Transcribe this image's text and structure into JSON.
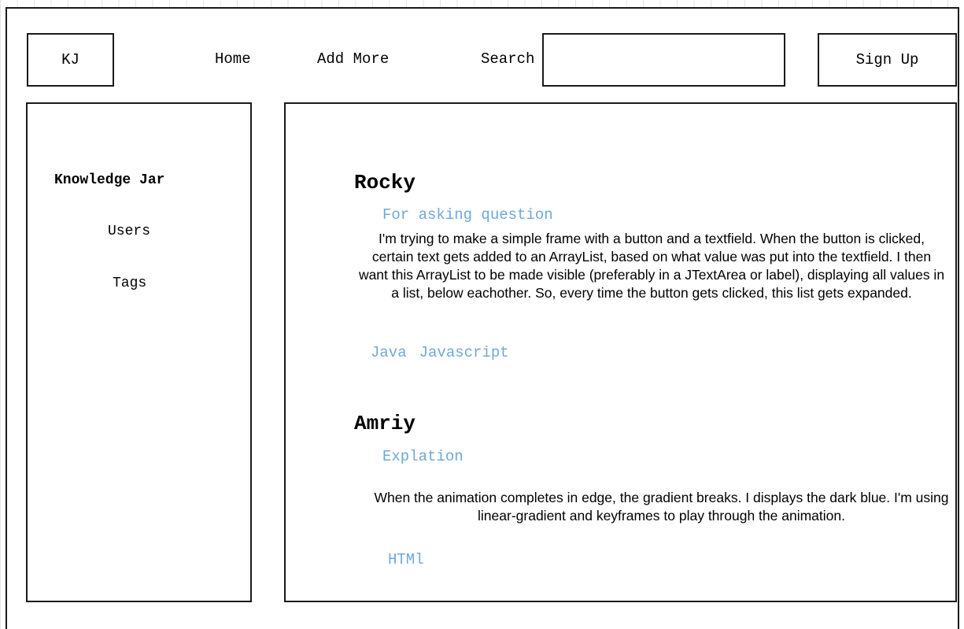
{
  "header": {
    "logo": "KJ",
    "nav": {
      "home": "Home",
      "add_more": "Add More"
    },
    "search": {
      "label": "Search",
      "value": ""
    },
    "signup": "Sign Up"
  },
  "sidebar": {
    "brand": "Knowledge Jar",
    "items": [
      {
        "label": "Users"
      },
      {
        "label": "Tags"
      }
    ]
  },
  "questions": [
    {
      "author": "Rocky",
      "title": "For asking question",
      "body": "I'm trying to make a simple frame with a button and a textfield. When  the button is clicked, certain text gets added to an ArrayList, based  on what value was put into the textfield. I then want this ArrayList to  be made visible (preferably in a JTextArea or label), displaying all  values in a list, below eachother. So, every time the button gets  clicked, this list gets expanded.",
      "tags": [
        "Java",
        "Javascript"
      ]
    },
    {
      "author": "Amriy",
      "title": "Explation",
      "body": "When the animation completes in edge, the gradient breaks. I displays  the dark blue. I'm using linear-gradient and keyframes to play through  the animation.",
      "tags": [
        "HTMl"
      ]
    }
  ],
  "colors": {
    "link_blue": "#6fa8dc",
    "border": "#1a1a1a"
  }
}
